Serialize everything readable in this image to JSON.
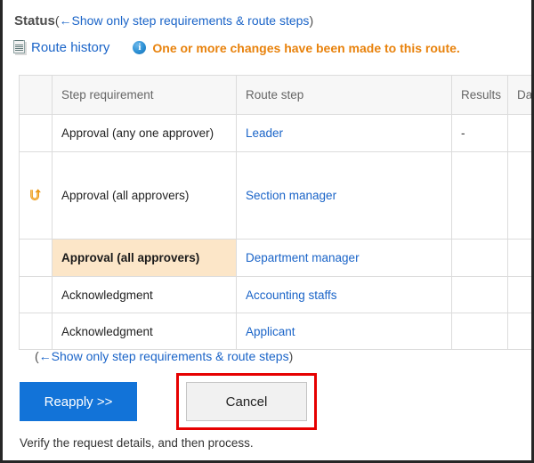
{
  "header": {
    "status_label": "Status",
    "open_paren": "(",
    "close_paren": ")",
    "arrow": "←",
    "toggle_link": "Show only step requirements & route steps"
  },
  "history": {
    "route_history_label": "Route history",
    "doc_icon_name": "document-icon",
    "info_icon_name": "info-icon",
    "info_glyph": "i",
    "notice": "One or more changes have been made to this route."
  },
  "table": {
    "columns": [
      "",
      "Step requirement",
      "Route step",
      "Results",
      "Date"
    ],
    "rows": [
      {
        "marker": "",
        "requirement": "Approval (any one approver)",
        "route_step": "Leader",
        "result": "-",
        "date": "",
        "current": false
      },
      {
        "marker": "uturn-icon",
        "requirement": "Approval (all approvers)",
        "route_step": "Section manager",
        "result": "",
        "date": "",
        "current": false
      },
      {
        "marker": "",
        "requirement": "Approval (all approvers)",
        "route_step": "Department manager",
        "result": "",
        "date": "",
        "current": true
      },
      {
        "marker": "",
        "requirement": "Acknowledgment",
        "route_step": "Accounting staffs",
        "result": "",
        "date": "",
        "current": false
      },
      {
        "marker": "",
        "requirement": "Acknowledgment",
        "route_step": "Applicant",
        "result": "",
        "date": "",
        "current": false
      }
    ]
  },
  "bottom": {
    "open_paren": "(",
    "close_paren": ")",
    "arrow": "←",
    "toggle_link": "Show only step requirements & route steps"
  },
  "actions": {
    "reapply_label": "Reapply >>",
    "cancel_label": "Cancel",
    "footer_note": "Verify the request details, and then process."
  },
  "colors": {
    "link": "#1a64c8",
    "warning": "#e8820c",
    "primary_button": "#1273d8",
    "current_row_highlight": "#fce6c8",
    "highlight_box": "#e60000"
  }
}
